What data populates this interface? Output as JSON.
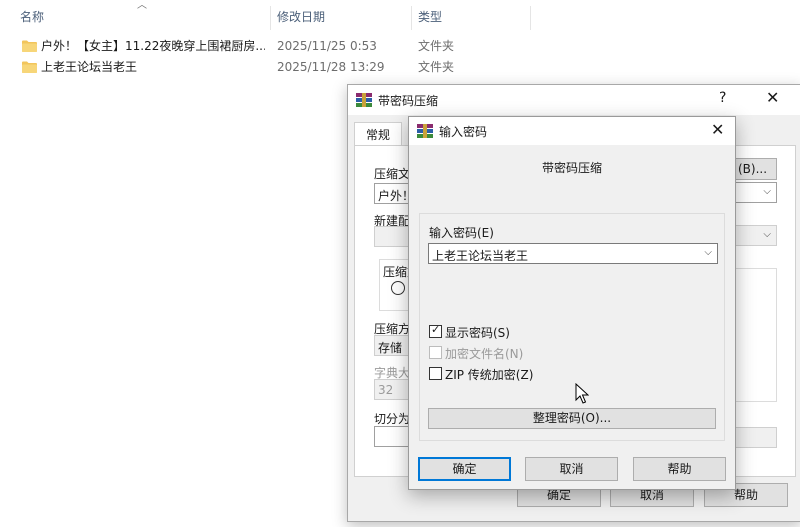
{
  "explorer": {
    "columns": {
      "name": "名称",
      "date": "修改日期",
      "type": "类型"
    },
    "files": [
      {
        "name": "户外！【女主】11.22夜晚穿上围裙厨房...",
        "date": "2025/11/25 0:53",
        "type": "文件夹"
      },
      {
        "name": "上老王论坛当老王",
        "date": "2025/11/28 13:29",
        "type": "文件夹"
      }
    ]
  },
  "back_dialog": {
    "title": "带密码压缩",
    "help_glyph": "?",
    "close_glyph": "✕",
    "tab_general": "常规",
    "browse_button_partial": "(B)...",
    "archive_name_label_partial": "压缩文",
    "archive_name_value_partial": "户外！",
    "profile_label_partial": "新建配",
    "format_label_partial": "压缩文",
    "method_label_partial": "压缩方",
    "method_value": "存储",
    "dict_label_partial": "字典大",
    "dict_value": "32",
    "split_label_partial": "切分为",
    "ok_button": "确定",
    "cancel_button": "取消",
    "help_button": "帮助"
  },
  "password_dialog": {
    "title": "输入密码",
    "close_glyph": "✕",
    "heading": "带密码压缩",
    "password_label": "输入密码(E)",
    "password_value": "上老王论坛当老王",
    "show_password": {
      "label": "显示密码(S)",
      "checked": true,
      "enabled": true
    },
    "encrypt_filenames": {
      "label": "加密文件名(N)",
      "checked": false,
      "enabled": false
    },
    "zip_legacy": {
      "label": "ZIP 传统加密(Z)",
      "checked": false,
      "enabled": true
    },
    "organize_button": "整理密码(O)...",
    "ok_button": "确定",
    "cancel_button": "取消",
    "help_button": "帮助"
  },
  "colors": {
    "accent": "#0078d7",
    "folder": "#f2c55c",
    "dialog_bg": "#f0f0f0"
  }
}
